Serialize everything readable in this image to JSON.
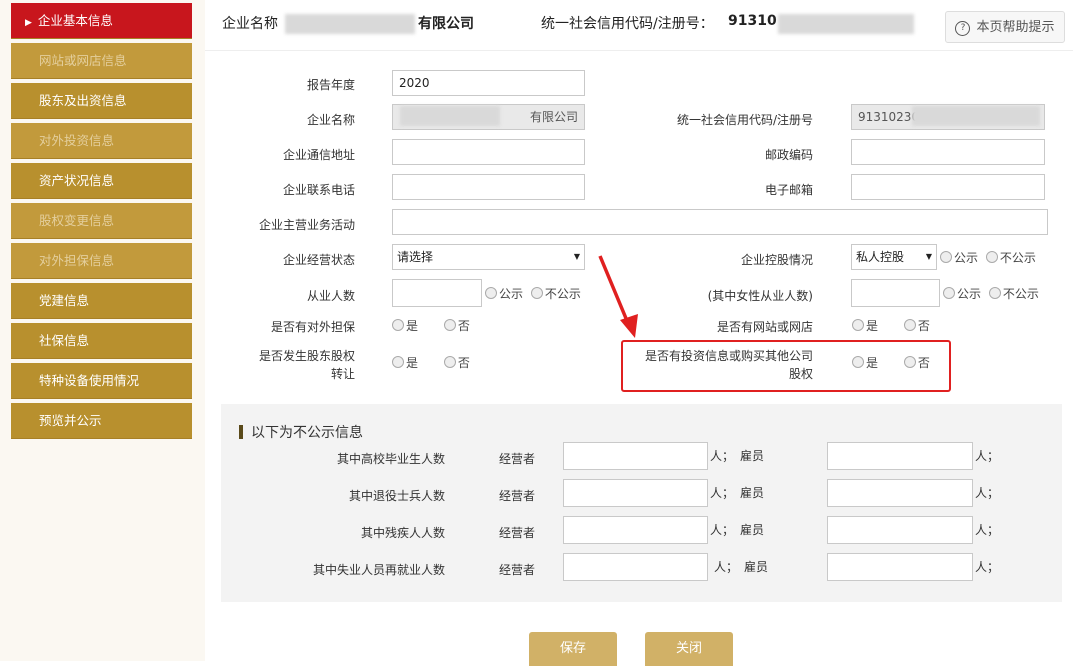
{
  "sidebar": {
    "items": [
      {
        "label": "企业基本信息"
      },
      {
        "label": "网站或网店信息"
      },
      {
        "label": "股东及出资信息"
      },
      {
        "label": "对外投资信息"
      },
      {
        "label": "资产状况信息"
      },
      {
        "label": "股权变更信息"
      },
      {
        "label": "对外担保信息"
      },
      {
        "label": "党建信息"
      },
      {
        "label": "社保信息"
      },
      {
        "label": "特种设备使用情况"
      },
      {
        "label": "预览并公示"
      }
    ],
    "active_arrow": "▶"
  },
  "header": {
    "company_label": "企业名称",
    "company_suffix": "有限公司",
    "credit_label": "统一社会信用代码/注册号：",
    "credit_prefix": "91310",
    "help_icon": "?",
    "help_label": "本页帮助提示"
  },
  "form": {
    "report_year": {
      "label": "报告年度",
      "value": "2020"
    },
    "company_name": {
      "label": "企业名称",
      "value_suffix": "有限公司"
    },
    "credit_code": {
      "label": "统一社会信用代码/注册号",
      "value_prefix": "91310230"
    },
    "address": {
      "label": "企业通信地址"
    },
    "postcode": {
      "label": "邮政编码"
    },
    "phone": {
      "label": "企业联系电话"
    },
    "email": {
      "label": "电子邮箱"
    },
    "business": {
      "label": "企业主营业务活动"
    },
    "status": {
      "label": "企业经营状态",
      "selected": "请选择"
    },
    "holding": {
      "label": "企业控股情况",
      "selected": "私人控股"
    },
    "employees": {
      "label": "从业人数"
    },
    "female": {
      "label": "(其中女性从业人数)"
    },
    "guarantee": {
      "label": "是否有对外担保"
    },
    "website": {
      "label": "是否有网站或网店"
    },
    "transfer": {
      "label_line1": "是否发生股东股权",
      "label_line2": "转让"
    },
    "invest": {
      "label_line1": "是否有投资信息或购买其他公司",
      "label_line2": "股权"
    },
    "opt_public": "公示",
    "opt_private": "不公示",
    "opt_yes": "是",
    "opt_no": "否",
    "caret": "▼"
  },
  "nonpublic": {
    "title": "以下为不公示信息",
    "operator": "经营者",
    "person_sep": "人；",
    "employee": "雇员",
    "rows": [
      {
        "label": "其中高校毕业生人数"
      },
      {
        "label": "其中退役士兵人数"
      },
      {
        "label": "其中残疾人人数"
      },
      {
        "label": "其中失业人员再就业人数"
      }
    ]
  },
  "buttons": {
    "save": "保存",
    "close": "关闭"
  },
  "colors": {
    "sidebar": "#b8902e",
    "active": "#c8161d",
    "highlight": "#e02020",
    "button": "#d1b167"
  }
}
